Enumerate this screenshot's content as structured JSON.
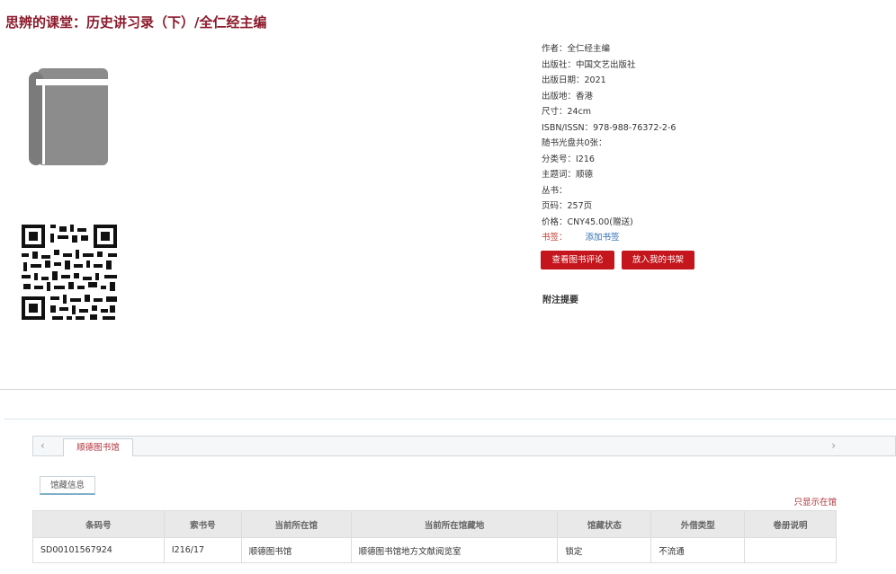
{
  "book": {
    "title": "思辨的课堂：历史讲习录（下）/全仁经主编",
    "cover_icon": "book-icon",
    "qr_icon": "qr-code-icon"
  },
  "meta": {
    "author": "作者：全仁经主编",
    "publisher": "出版社：中国文艺出版社",
    "pub_date": "出版日期：2021",
    "pub_place": "出版地：香港",
    "size": "尺寸：24cm",
    "isbn": "ISBN/ISSN：978-988-76372-2-6",
    "disc": "随书光盘共0张：",
    "class_no": "分类号：I216",
    "subject": "主题词：顺德",
    "series": "丛书：",
    "pages": "页码：257页",
    "price": "价格：CNY45.00(赠送)",
    "bookmark_label": "书签：",
    "bookmark_link": "添加书签"
  },
  "buttons": {
    "review": "查看图书评论",
    "shelf": "放入我的书架"
  },
  "notes_label": "附注提要",
  "holdings": {
    "library_tab": "顺德图书馆",
    "sub_tab": "馆藏信息",
    "show_all": "只显示在馆",
    "nav_left": "‹",
    "nav_right": "›",
    "columns": [
      "条码号",
      "索书号",
      "当前所在馆",
      "当前所在馆藏地",
      "馆藏状态",
      "外借类型",
      "卷册说明"
    ],
    "rows": [
      [
        "SD00101567924",
        "I216/17",
        "顺德图书馆",
        "顺德图书馆地方文献阅览室",
        "锁定",
        "不流通",
        ""
      ]
    ]
  }
}
